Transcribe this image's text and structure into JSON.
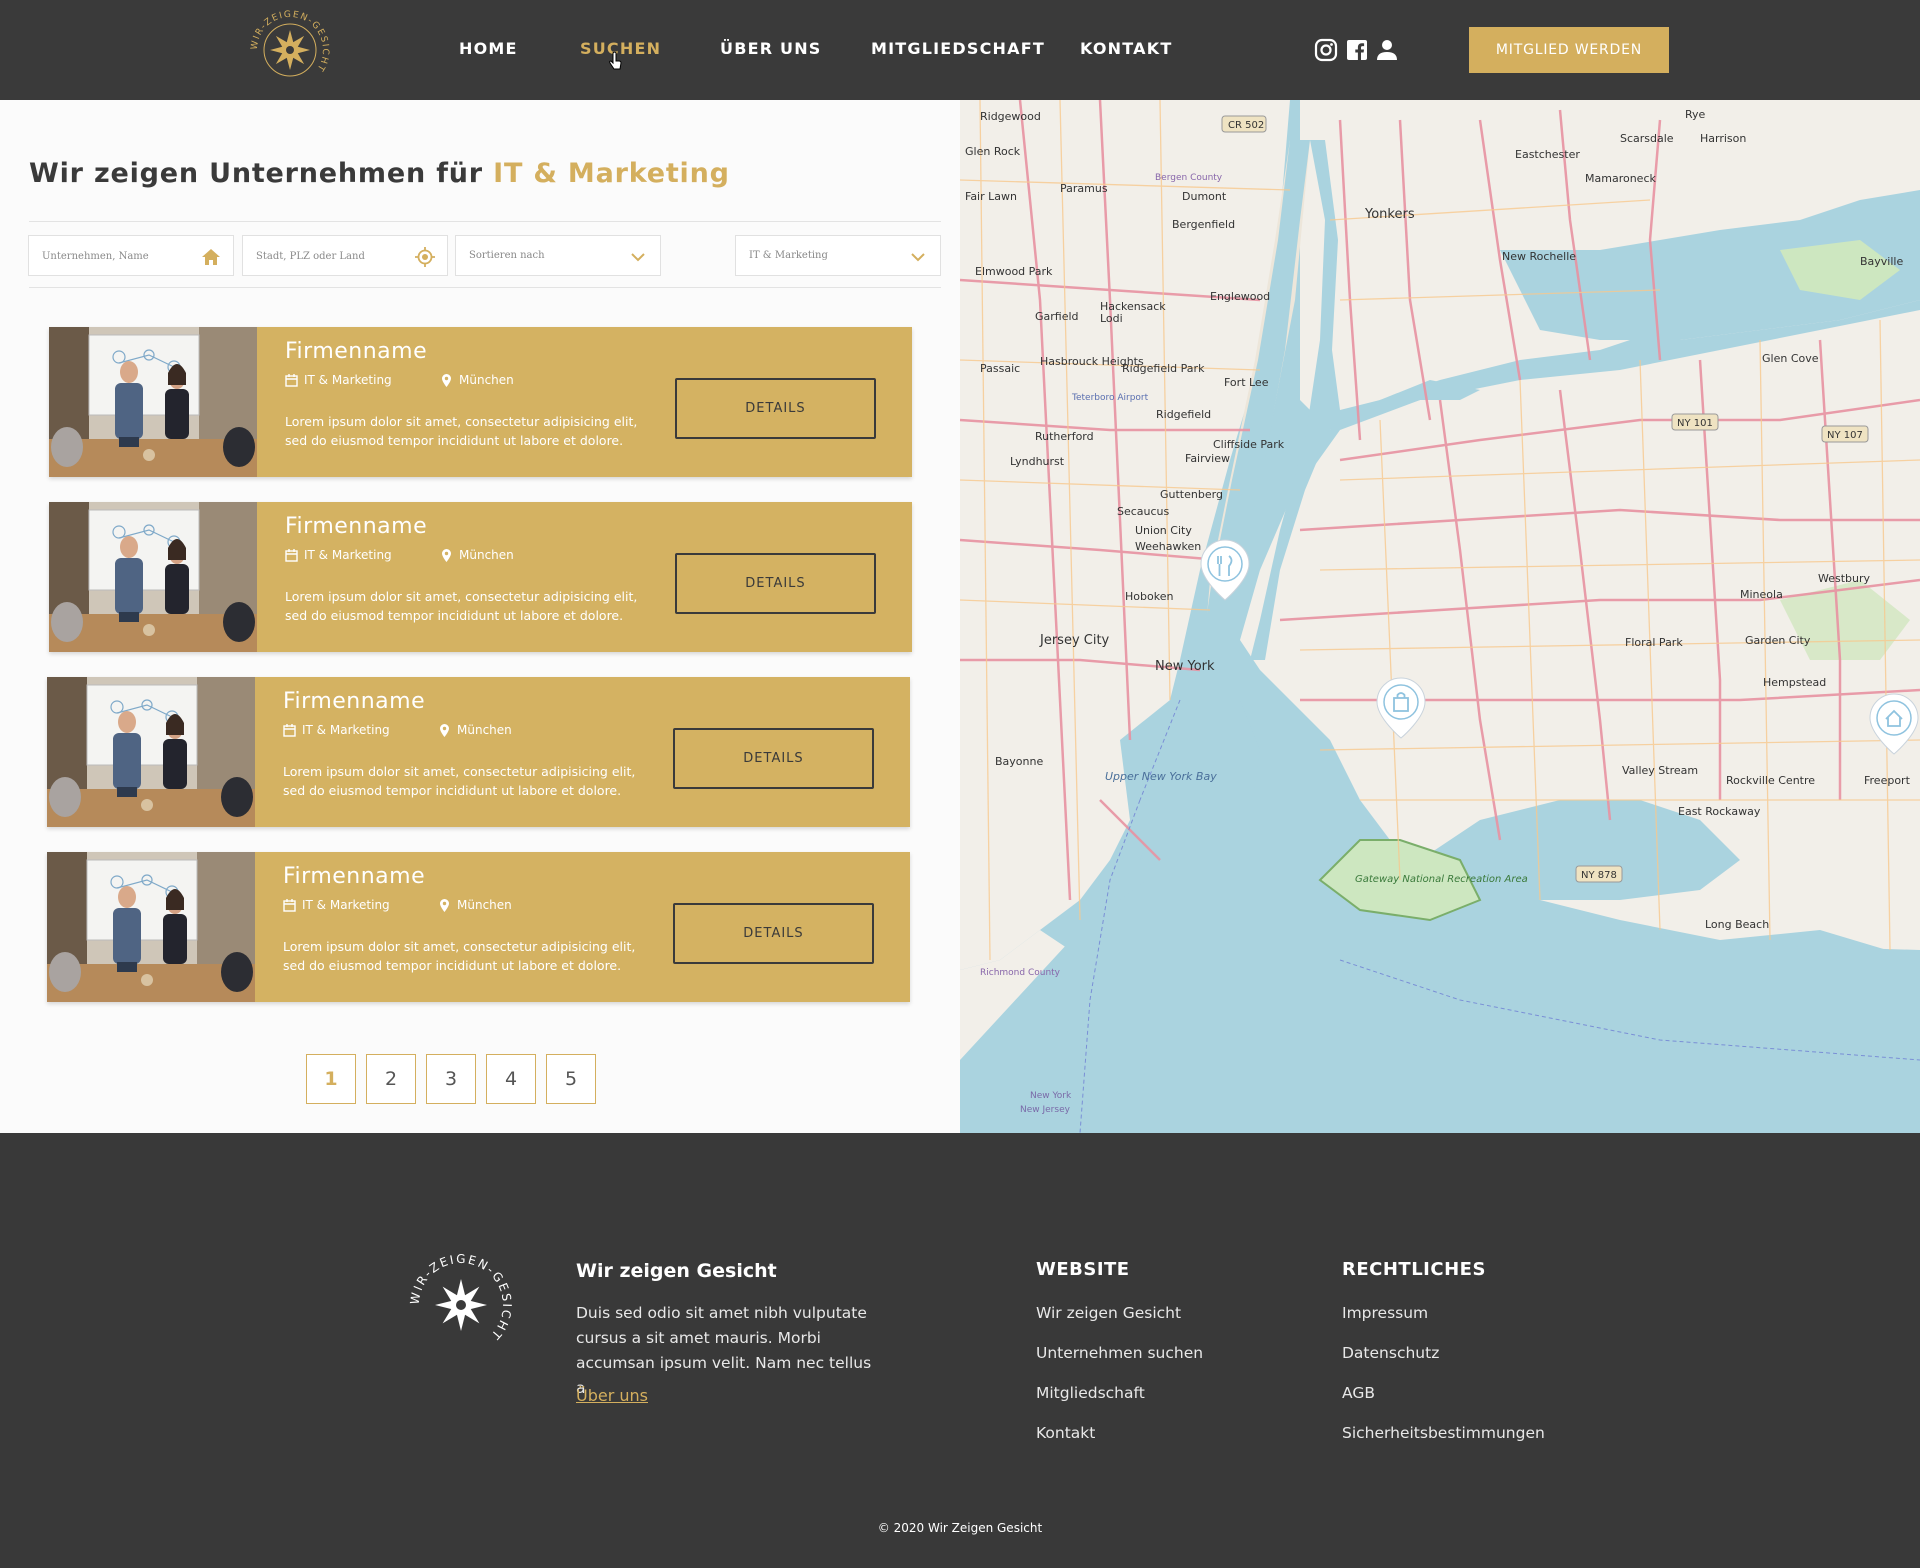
{
  "header": {
    "nav": [
      "HOME",
      "SUCHEN",
      "ÜBER UNS",
      "MITGLIEDSCHAFT",
      "KONTAKT"
    ],
    "cta": "MITGLIED WERDEN",
    "brand_logo_text": "WIR-ZEIGEN-GESICHT"
  },
  "search": {
    "title_prefix": "Wir zeigen Unternehmen für ",
    "title_highlight": "IT & Marketing",
    "company_placeholder": "Unternehmen, Name",
    "location_placeholder": "Stadt, PLZ oder Land",
    "sort_label": "Sortieren nach",
    "category_label": "IT & Marketing"
  },
  "results": [
    {
      "name": "Firmenname",
      "category": "IT & Marketing",
      "city": "München",
      "description": "Lorem ipsum dolor sit amet, consectetur adipisicing elit, sed do eiusmod tempor incididunt ut labore et dolore.",
      "button": "DETAILS"
    },
    {
      "name": "Firmenname",
      "category": "IT & Marketing",
      "city": "München",
      "description": "Lorem ipsum dolor sit amet, consectetur adipisicing elit, sed do eiusmod tempor incididunt ut labore et dolore.",
      "button": "DETAILS"
    },
    {
      "name": "Firmenname",
      "category": "IT & Marketing",
      "city": "München",
      "description": "Lorem ipsum dolor sit amet, consectetur adipisicing elit, sed do eiusmod tempor incididunt ut labore et dolore.",
      "button": "DETAILS"
    },
    {
      "name": "Firmenname",
      "category": "IT & Marketing",
      "city": "München",
      "description": "Lorem ipsum dolor sit amet, consectetur adipisicing elit, sed do eiusmod tempor incididunt ut labore et dolore.",
      "button": "DETAILS"
    }
  ],
  "pagination": [
    "1",
    "2",
    "3",
    "4",
    "5"
  ],
  "map": {
    "labels": [
      "Ridgewood",
      "Glen Rock",
      "Paramus",
      "Dumont",
      "Bergenfield",
      "Yonkers",
      "Eastchester",
      "Scarsdale",
      "Harrison",
      "Rye",
      "Mamaroneck",
      "New Rochelle",
      "Englewood",
      "Hackensack",
      "Garfield",
      "Lodi",
      "Ridgefield Park",
      "Fort Lee",
      "Hasbrouck Heights",
      "Passaic",
      "Ridgefield",
      "Cliffside Park",
      "Fairview",
      "Rutherford",
      "Lyndhurst",
      "Secaucus",
      "Guttenberg",
      "Union City",
      "Weehawken",
      "Hoboken",
      "Jersey City",
      "New York",
      "Bayonne",
      "Upper New York Bay",
      "Glen Cove",
      "Westbury",
      "Mineola",
      "Floral Park",
      "Garden City",
      "Hempstead",
      "Valley Stream",
      "Rockville Centre",
      "Freeport",
      "East Rockaway",
      "Long Beach",
      "Gateway National Recreation Area",
      "Richmond County",
      "Bergen County",
      "Teterboro Airport",
      "Fair Lawn",
      "Elmwood Park",
      "Bayville",
      "New York",
      "New Jersey"
    ],
    "route_badges": [
      "CR 502",
      "NY 101",
      "NY 107",
      "NY 878"
    ]
  },
  "footer": {
    "brand_title": "Wir zeigen Gesicht",
    "brand_text": "Duis sed odio sit amet nibh vulputate cursus a sit amet mauris. Morbi accumsan ipsum velit. Nam nec tellus a",
    "about_link": "Über uns",
    "website_heading": "WEBSITE",
    "website_links": [
      "Wir zeigen Gesicht",
      "Unternehmen suchen",
      "Mitgliedschaft",
      "Kontakt"
    ],
    "legal_heading": "RECHTLICHES",
    "legal_links": [
      "Impressum",
      "Datenschutz",
      "AGB",
      "Sicherheitsbestimmungen"
    ],
    "copyright": "© 2020 Wir Zeigen Gesicht"
  },
  "colors": {
    "accent": "#d4af5e",
    "card": "#d4b262",
    "dark": "#3a3a3a",
    "water": "#aad3df",
    "land": "#f2efe9",
    "park": "#cde7c0"
  },
  "icons": [
    "home-icon",
    "location-target-icon",
    "chevron-down-icon",
    "calendar-icon",
    "map-pin-icon",
    "instagram-icon",
    "facebook-icon",
    "user-icon",
    "restaurant-marker-icon",
    "shopping-marker-icon",
    "home-marker-icon"
  ]
}
